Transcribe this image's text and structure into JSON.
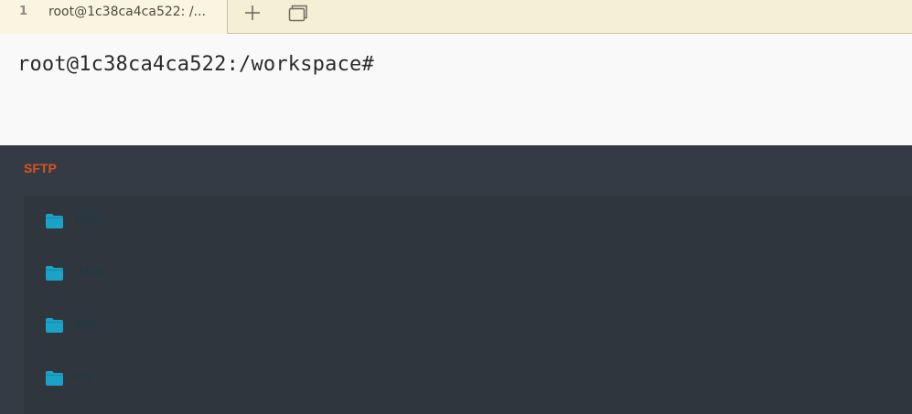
{
  "tabs": [
    {
      "index": "1",
      "title": "root@1c38ca4ca522: /..."
    }
  ],
  "terminal": {
    "prompt": "root@1c38ca4ca522:/workspace#"
  },
  "sftp": {
    "title": "SFTP",
    "items": [
      {
        "name": "boot",
        "icon": "folder-icon"
      },
      {
        "name": "data",
        "icon": "folder-icon"
      },
      {
        "name": "dev",
        "icon": "folder-icon"
      },
      {
        "name": "etc",
        "icon": "folder-icon"
      }
    ]
  },
  "colors": {
    "accent": "#d9531e",
    "folder": "#1aa3c7",
    "panel_bg": "#353b44"
  }
}
